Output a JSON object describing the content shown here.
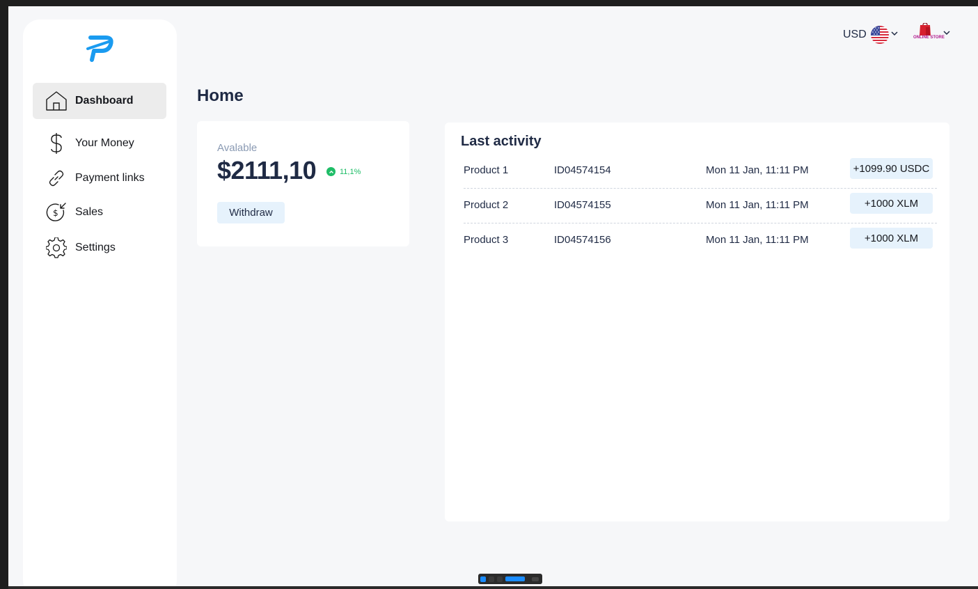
{
  "sidebar": {
    "logo": "logo-icon",
    "items": [
      {
        "label": "Dashboard",
        "icon": "home-icon",
        "active": true
      },
      {
        "label": "Your Money",
        "icon": "dollar-icon",
        "active": false
      },
      {
        "label": "Payment links",
        "icon": "link-icon",
        "active": false
      },
      {
        "label": "Sales",
        "icon": "money-in-icon",
        "active": false
      },
      {
        "label": "Settings",
        "icon": "gear-icon",
        "active": false
      }
    ]
  },
  "header": {
    "currency": "USD",
    "currency_flag": "us-flag-icon",
    "store_logo_text": "ONLINE STORE"
  },
  "page": {
    "title": "Home"
  },
  "balance": {
    "label": "Avalable",
    "amount": "$2111,10",
    "change": "11,1%",
    "withdraw_label": "Withdraw"
  },
  "activity": {
    "title": "Last activity",
    "rows": [
      {
        "product": "Product 1",
        "id": "ID04574154",
        "date": "Mon 11 Jan, 11:11 PM",
        "amount": "+1099.90 USDC"
      },
      {
        "product": "Product 2",
        "id": "ID04574155",
        "date": "Mon 11 Jan, 11:11 PM",
        "amount": "+1000 XLM"
      },
      {
        "product": "Product 3",
        "id": "ID04574156",
        "date": "Mon 11 Jan, 11:11 PM",
        "amount": "+1000 XLM"
      }
    ]
  },
  "colors": {
    "accent": "#1a9bf0",
    "positive": "#1fbd67",
    "chip_bg": "#e6f2fc",
    "text_primary": "#1f2a44"
  }
}
